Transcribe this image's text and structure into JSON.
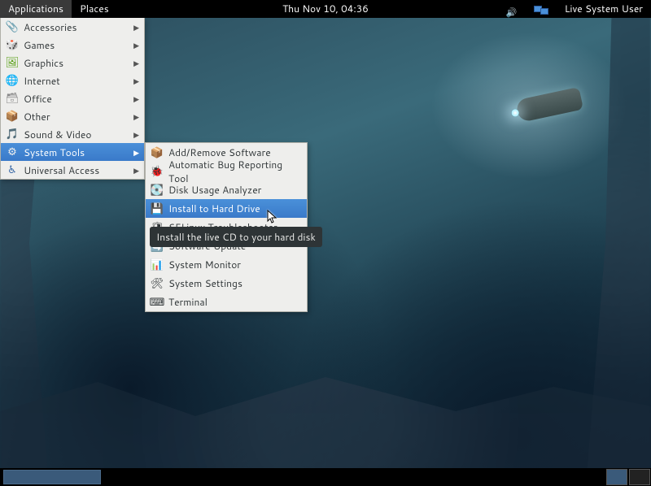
{
  "top_panel": {
    "applications": "Applications",
    "places": "Places",
    "clock": "Thu Nov 10, 04:36",
    "user": "Live System User"
  },
  "main_menu": [
    {
      "label": "Accessories",
      "icon": "📎",
      "cls": "ic-accessories",
      "highlight": false
    },
    {
      "label": "Games",
      "icon": "🎲",
      "cls": "ic-games",
      "highlight": false
    },
    {
      "label": "Graphics",
      "icon": "🖼",
      "cls": "ic-graphics",
      "highlight": false
    },
    {
      "label": "Internet",
      "icon": "🌐",
      "cls": "ic-internet",
      "highlight": false
    },
    {
      "label": "Office",
      "icon": "🗃",
      "cls": "ic-office",
      "highlight": false
    },
    {
      "label": "Other",
      "icon": "📦",
      "cls": "ic-other",
      "highlight": false
    },
    {
      "label": "Sound & Video",
      "icon": "🎵",
      "cls": "ic-sound",
      "highlight": false
    },
    {
      "label": "System Tools",
      "icon": "⚙",
      "cls": "ic-system",
      "highlight": true
    },
    {
      "label": "Universal Access",
      "icon": "♿",
      "cls": "ic-universal",
      "highlight": false
    }
  ],
  "submenu": [
    {
      "label": "Add/Remove Software",
      "icon": "📦",
      "highlight": false
    },
    {
      "label": "Automatic Bug Reporting Tool",
      "icon": "🐞",
      "highlight": false
    },
    {
      "label": "Disk Usage Analyzer",
      "icon": "💽",
      "highlight": false
    },
    {
      "label": "Install to Hard Drive",
      "icon": "💾",
      "highlight": true
    },
    {
      "label": "SELinux Troubleshooter",
      "icon": "🛡",
      "highlight": false
    },
    {
      "label": "Software Update",
      "icon": "🔄",
      "highlight": false
    },
    {
      "label": "System Monitor",
      "icon": "📊",
      "highlight": false
    },
    {
      "label": "System Settings",
      "icon": "🛠",
      "highlight": false
    },
    {
      "label": "Terminal",
      "icon": "⌨",
      "highlight": false
    }
  ],
  "tooltip": "Install the live CD to your hard disk"
}
